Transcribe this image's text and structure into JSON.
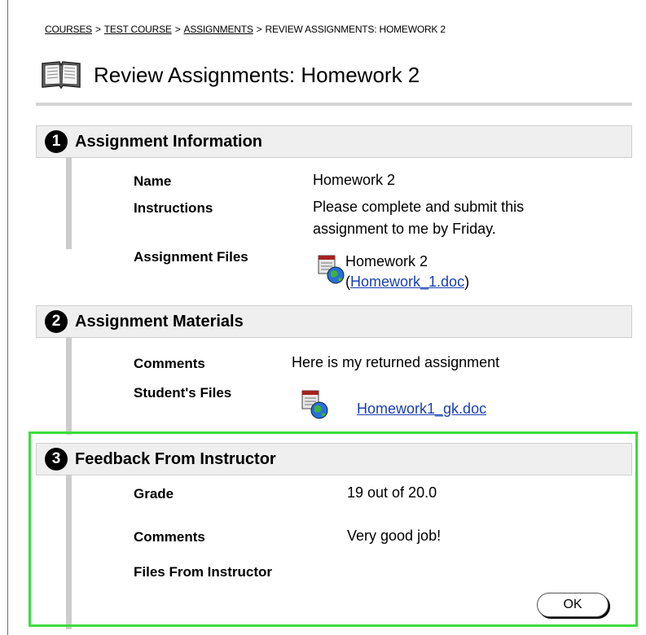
{
  "breadcrumb": {
    "items": [
      "COURSES",
      "TEST COURSE",
      "ASSIGNMENTS"
    ],
    "current": "REVIEW ASSIGNMENTS: HOMEWORK 2",
    "separator": ">"
  },
  "page": {
    "title": "Review Assignments: Homework 2",
    "icon": "open-book-icon"
  },
  "section1": {
    "number": "1",
    "title": "Assignment Information",
    "name_label": "Name",
    "name_value": "Homework 2",
    "instructions_label": "Instructions",
    "instructions_line1": "Please complete and submit this",
    "instructions_line2": "assignment to me by Friday.",
    "files_label": "Assignment Files",
    "file_title": "Homework 2",
    "file_open": "(",
    "file_link": "Homework_1.doc",
    "file_close": ")"
  },
  "section2": {
    "number": "2",
    "title": "Assignment Materials",
    "comments_label": "Comments",
    "comments_value": "Here is my returned assignment",
    "files_label": "Student's Files",
    "file_link": "Homework1_gk.doc"
  },
  "section3": {
    "number": "3",
    "title": "Feedback From Instructor",
    "grade_label": "Grade",
    "grade_value": "19 out of 20.0",
    "comments_label": "Comments",
    "comments_value": "Very good job!",
    "files_label": "Files From Instructor"
  },
  "buttons": {
    "ok": "OK"
  },
  "colors": {
    "highlight": "#3ddc3d",
    "link": "#1a3fb0",
    "header_bg": "#efefef"
  }
}
